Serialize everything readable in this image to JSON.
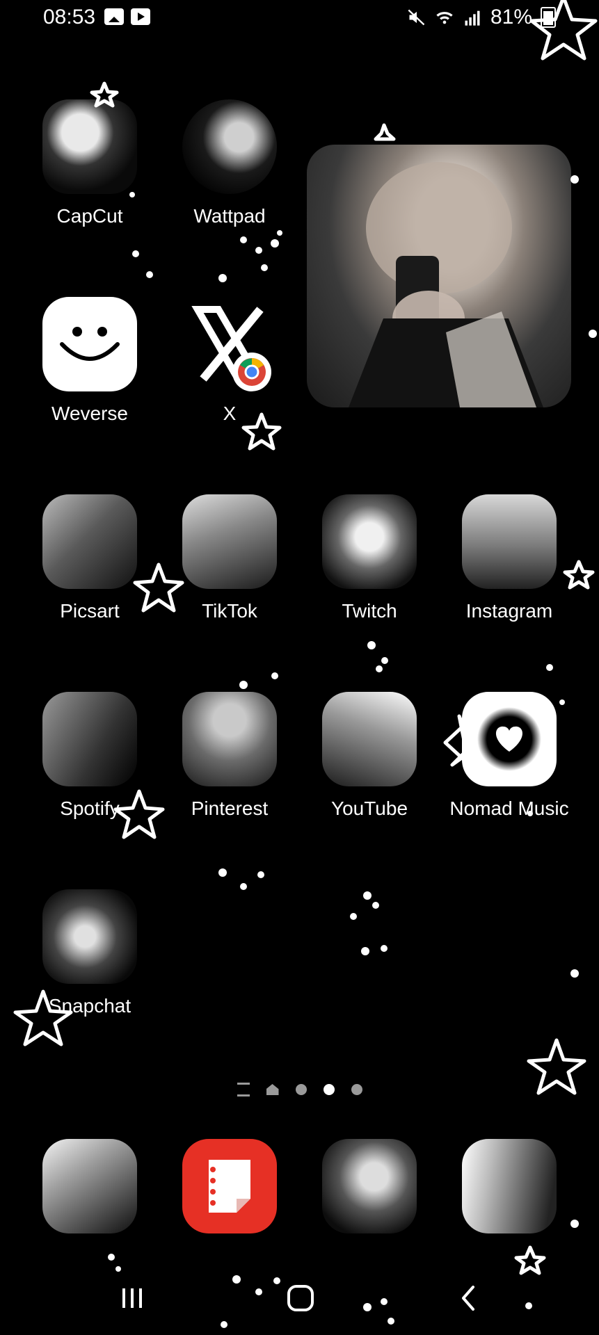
{
  "status_bar": {
    "time": "08:53",
    "left_icons": [
      "gallery-icon",
      "youtube-notification-icon"
    ],
    "right_icons": [
      "mute-icon",
      "wifi-icon",
      "signal-icon"
    ],
    "battery": "81%"
  },
  "apps": {
    "capcut": "CapCut",
    "wattpad": "Wattpad",
    "weverse": "Weverse",
    "x": "X",
    "picsart": "Picsart",
    "tiktok": "TikTok",
    "twitch": "Twitch",
    "instagram": "Instagram",
    "spotify": "Spotify",
    "pinterest": "Pinterest",
    "youtube": "YouTube",
    "nomad_music": "Nomad Music",
    "snapchat": "Snapchat"
  },
  "page_indicator": {
    "pages": 3,
    "active_index": 1
  },
  "nav_bar": {
    "buttons": [
      "recents-icon",
      "home-icon",
      "back-icon"
    ]
  },
  "colors": {
    "background": "#000000",
    "text": "#ffffff",
    "notes_red": "#e63025",
    "dot_inactive": "#9a9a9a"
  }
}
